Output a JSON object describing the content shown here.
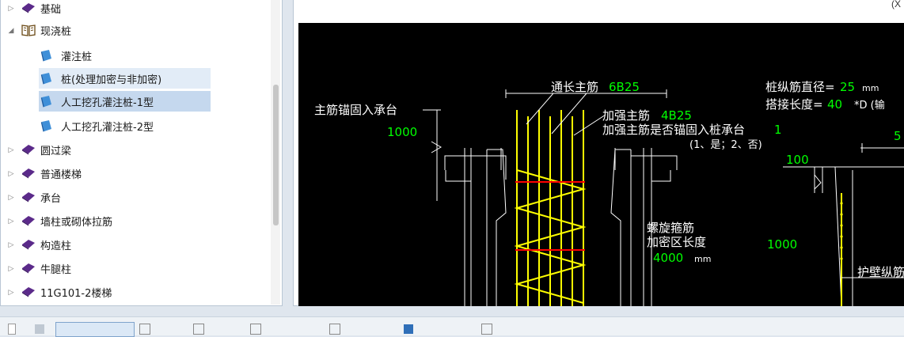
{
  "tree": {
    "items": [
      {
        "label": "基础",
        "icon": "book-closed-icon"
      },
      {
        "label": "现浇桩",
        "icon": "book-open-icon"
      },
      {
        "label": "灌注桩",
        "icon": "document-icon"
      },
      {
        "label": "桩(处理加密与非加密)",
        "icon": "document-icon"
      },
      {
        "label": "人工挖孔灌注桩-1型",
        "icon": "document-icon"
      },
      {
        "label": "人工挖孔灌注桩-2型",
        "icon": "document-icon"
      },
      {
        "label": "圆过梁",
        "icon": "book-closed-icon"
      },
      {
        "label": "普通楼梯",
        "icon": "book-closed-icon"
      },
      {
        "label": "承台",
        "icon": "book-closed-icon"
      },
      {
        "label": "墙柱或砌体拉筋",
        "icon": "book-closed-icon"
      },
      {
        "label": "构造柱",
        "icon": "book-closed-icon"
      },
      {
        "label": "牛腿柱",
        "icon": "book-closed-icon"
      },
      {
        "label": "11G101-2楼梯",
        "icon": "book-closed-icon"
      }
    ]
  },
  "right_pane": {
    "corner_text": "(X"
  },
  "cad": {
    "main_rebar_label": "通长主筋",
    "main_rebar_value": "6B25",
    "anchor_label": "主筋锚固入承台",
    "anchor_value": "1000",
    "reinforce_label": "加强主筋",
    "reinforce_value": "4B25",
    "reinforce_anchor_label": "加强主筋是否锚固入桩承台",
    "reinforce_anchor_value": "1",
    "reinforce_anchor_options": "(1、是；2、否)",
    "pile_dia_label": "桩纵筋直径=",
    "pile_dia_value": "25",
    "pile_dia_unit": "mm",
    "lap_label": "搭接长度=",
    "lap_value": "40",
    "lap_suffix": "*D (输",
    "spiral_label": "螺旋箍筋",
    "dense_label": "加密区长度",
    "dense_value": "4000",
    "dense_unit": "mm",
    "right_top_value": "5",
    "right_100": "100",
    "right_1000": "1000",
    "protect_wall_label": "护壁纵筋"
  },
  "colors": {
    "cad_bg": "#000000",
    "white": "#ffffff",
    "yellow": "#ffff00",
    "red": "#ff0000",
    "green": "#00ff00"
  }
}
